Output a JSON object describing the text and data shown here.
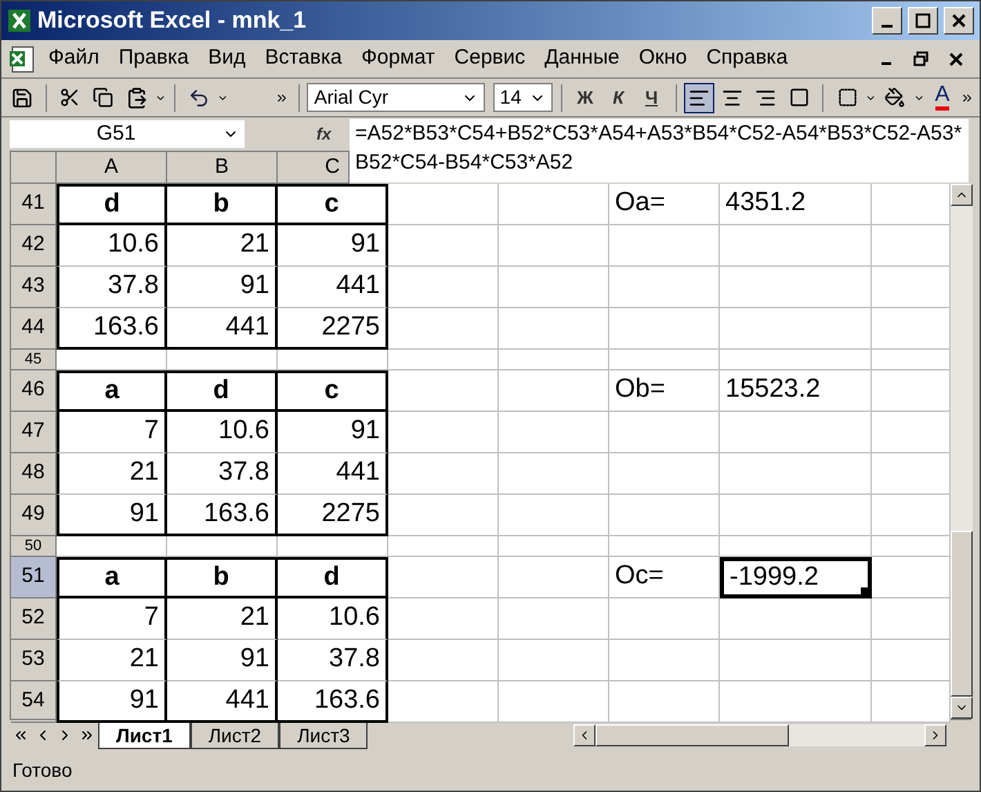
{
  "window": {
    "title": "Microsoft Excel - mnk_1"
  },
  "menu": [
    {
      "label": "Файл"
    },
    {
      "label": "Правка"
    },
    {
      "label": "Вид"
    },
    {
      "label": "Вставка"
    },
    {
      "label": "Формат"
    },
    {
      "label": "Сервис"
    },
    {
      "label": "Данные"
    },
    {
      "label": "Окно"
    },
    {
      "label": "Справка"
    }
  ],
  "toolbar": {
    "font": "Arial Cyr",
    "size": "14",
    "bold": "Ж",
    "italic": "К",
    "underline": "Ч",
    "font_color": "A",
    "align": [
      {
        "kind": "left",
        "selected": true
      },
      {
        "kind": "center",
        "selected": false
      },
      {
        "kind": "right",
        "selected": false
      }
    ]
  },
  "formula_bar": {
    "name_box": "G51",
    "fx": "fx",
    "formula": "=A52*B53*C54+B52*C53*A54+A53*B54*C52-A54*B53*C52-A53*B52*C54-B54*C53*A52"
  },
  "columns": [
    "A",
    "B",
    "C"
  ],
  "rows": [
    {
      "header": "41",
      "kind": "header",
      "selected": false,
      "cells": [
        {
          "text": "d",
          "selected": false
        },
        {
          "text": "b",
          "selected": false
        },
        {
          "text": "c",
          "selected": false
        }
      ],
      "label": {
        "text": "Oa=",
        "selected": false
      },
      "value": {
        "text": "4351.2",
        "selected": false
      }
    },
    {
      "header": "42",
      "kind": "data",
      "selected": false,
      "cells": [
        {
          "text": "10.6",
          "selected": false
        },
        {
          "text": "21",
          "selected": false
        },
        {
          "text": "91",
          "selected": false
        }
      ]
    },
    {
      "header": "43",
      "kind": "data",
      "selected": false,
      "cells": [
        {
          "text": "37.8",
          "selected": false
        },
        {
          "text": "91",
          "selected": false
        },
        {
          "text": "441",
          "selected": false
        }
      ]
    },
    {
      "header": "44",
      "kind": "data",
      "selected": false,
      "cells": [
        {
          "text": "163.6",
          "selected": false
        },
        {
          "text": "441",
          "selected": false
        },
        {
          "text": "2275",
          "selected": false
        }
      ]
    },
    {
      "header": "45",
      "kind": "spacer",
      "selected": false
    },
    {
      "header": "46",
      "kind": "header",
      "selected": false,
      "cells": [
        {
          "text": "a",
          "selected": false
        },
        {
          "text": "d",
          "selected": false
        },
        {
          "text": "c",
          "selected": false
        }
      ],
      "label": {
        "text": "Ob=",
        "selected": false
      },
      "value": {
        "text": "15523.2",
        "selected": false
      }
    },
    {
      "header": "47",
      "kind": "data",
      "selected": false,
      "cells": [
        {
          "text": "7",
          "selected": false
        },
        {
          "text": "10.6",
          "selected": false
        },
        {
          "text": "91",
          "selected": false
        }
      ]
    },
    {
      "header": "48",
      "kind": "data",
      "selected": false,
      "cells": [
        {
          "text": "21",
          "selected": false
        },
        {
          "text": "37.8",
          "selected": false
        },
        {
          "text": "441",
          "selected": false
        }
      ]
    },
    {
      "header": "49",
      "kind": "data",
      "selected": false,
      "cells": [
        {
          "text": "91",
          "selected": false
        },
        {
          "text": "163.6",
          "selected": false
        },
        {
          "text": "2275",
          "selected": false
        }
      ]
    },
    {
      "header": "50",
      "kind": "spacer",
      "selected": false
    },
    {
      "header": "51",
      "kind": "header",
      "selected": true,
      "cells": [
        {
          "text": "a",
          "selected": false
        },
        {
          "text": "b",
          "selected": false
        },
        {
          "text": "d",
          "selected": false
        }
      ],
      "label": {
        "text": "Oc=",
        "selected": false
      },
      "value": {
        "text": "-1999.2",
        "selected": true
      }
    },
    {
      "header": "52",
      "kind": "data",
      "selected": false,
      "cells": [
        {
          "text": "7",
          "selected": false
        },
        {
          "text": "21",
          "selected": false
        },
        {
          "text": "10.6",
          "selected": false
        }
      ]
    },
    {
      "header": "53",
      "kind": "data",
      "selected": false,
      "cells": [
        {
          "text": "21",
          "selected": false
        },
        {
          "text": "91",
          "selected": false
        },
        {
          "text": "37.8",
          "selected": false
        }
      ]
    },
    {
      "header": "54",
      "kind": "data",
      "selected": false,
      "cells": [
        {
          "text": "91",
          "selected": false
        },
        {
          "text": "441",
          "selected": false
        },
        {
          "text": "163.6",
          "selected": false
        }
      ]
    }
  ],
  "sheet_tabs": [
    {
      "label": "Лист1",
      "selected": true
    },
    {
      "label": "Лист2",
      "selected": false
    },
    {
      "label": "Лист3",
      "selected": false
    }
  ],
  "status_bar": {
    "text": "Готово"
  }
}
